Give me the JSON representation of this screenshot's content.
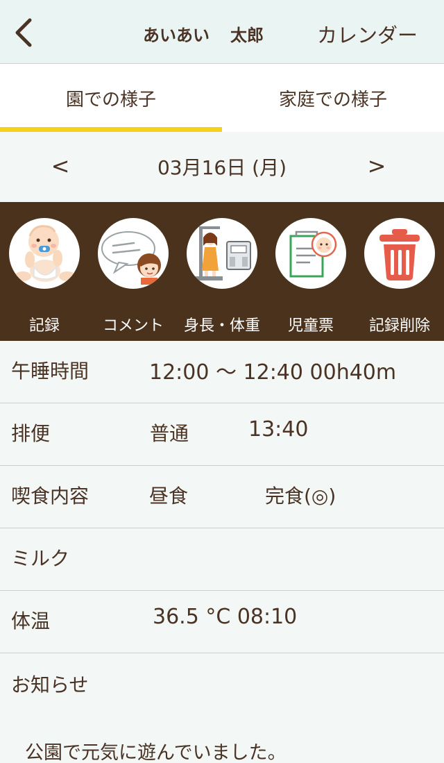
{
  "header": {
    "child_first": "あいあい",
    "child_last": "太郎",
    "calendar_label": "カレンダー"
  },
  "tabs": [
    {
      "label": "園での様子",
      "active": true
    },
    {
      "label": "家庭での様子",
      "active": false
    }
  ],
  "date_nav": {
    "prev": "<",
    "date": "03月16日 (月)",
    "next": ">"
  },
  "actions": [
    {
      "label": "記録",
      "icon": "baby-icon"
    },
    {
      "label": "コメント",
      "icon": "comment-bubble-icon"
    },
    {
      "label": "身長・体重",
      "icon": "height-weight-icon"
    },
    {
      "label": "児童票",
      "icon": "child-record-sheet-icon"
    },
    {
      "label": "記録削除",
      "icon": "trash-icon"
    }
  ],
  "records": {
    "nap": {
      "label": "午睡時間",
      "value": "12:00 〜 12:40  00h40m"
    },
    "stool": {
      "label": "排便",
      "state": "普通",
      "time": "13:40"
    },
    "meal": {
      "label": "喫食内容",
      "meal": "昼食",
      "amount": "完食(◎)"
    },
    "milk": {
      "label": "ミルク"
    },
    "temp": {
      "label": "体温",
      "value": "36.5 °C  08:10"
    }
  },
  "notice": {
    "label": "お知らせ",
    "text": "公園で元気に遊んでいました。"
  },
  "colors": {
    "header_bg": "#eaf5f3",
    "tab_indicator": "#f6d21d",
    "action_bar_bg": "#4b321c",
    "text": "#4a3324"
  }
}
